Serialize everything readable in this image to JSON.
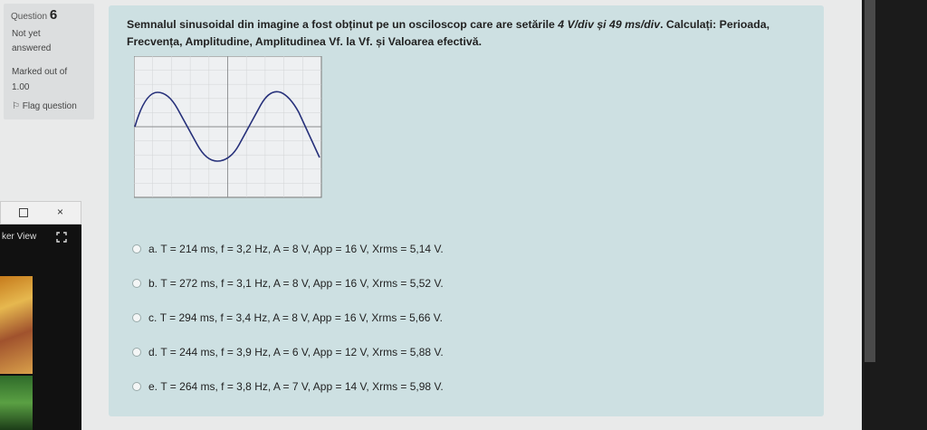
{
  "question_info": {
    "label": "Question",
    "number": "6",
    "status": "Not yet answered",
    "marked": "Marked out of 1.00",
    "flag": "Flag question"
  },
  "question": {
    "text_part1": "Semnalul sinusoidal din imagine a fost obținut pe un osciloscop care are setările ",
    "settings": "4 V/div și 49 ms/div",
    "text_part2": ". Calculați: Perioada, Frecvența, Amplitudine, Amplitudinea Vf. la Vf. și Valoarea efectivă."
  },
  "answers": [
    {
      "letter": "a.",
      "text": "T = 214 ms, f = 3,2 Hz, A = 8 V, App = 16 V, Xrms = 5,14 V."
    },
    {
      "letter": "b.",
      "text": "T = 272 ms, f = 3,1 Hz, A = 8 V, App = 16 V, Xrms = 5,52 V."
    },
    {
      "letter": "c.",
      "text": "T = 294 ms, f = 3,4 Hz, A = 8 V, App = 16 V, Xrms = 5,66 V."
    },
    {
      "letter": "d.",
      "text": "T = 244 ms, f = 3,9 Hz, A = 6 V, App = 12 V, Xrms = 5,88 V."
    },
    {
      "letter": "e.",
      "text": "T = 264 ms, f = 3,8 Hz, A = 7 V, App = 14 V, Xrms = 5,98 V."
    }
  ],
  "viewer_panel": {
    "label": "ker View",
    "close": "×"
  },
  "colors": {
    "question_bg": "#cde0e2",
    "info_bg": "#dcdedf",
    "signal": "#26307a"
  },
  "icons": [
    "flag-icon",
    "close-icon",
    "maximize-icon",
    "expand-icon"
  ]
}
